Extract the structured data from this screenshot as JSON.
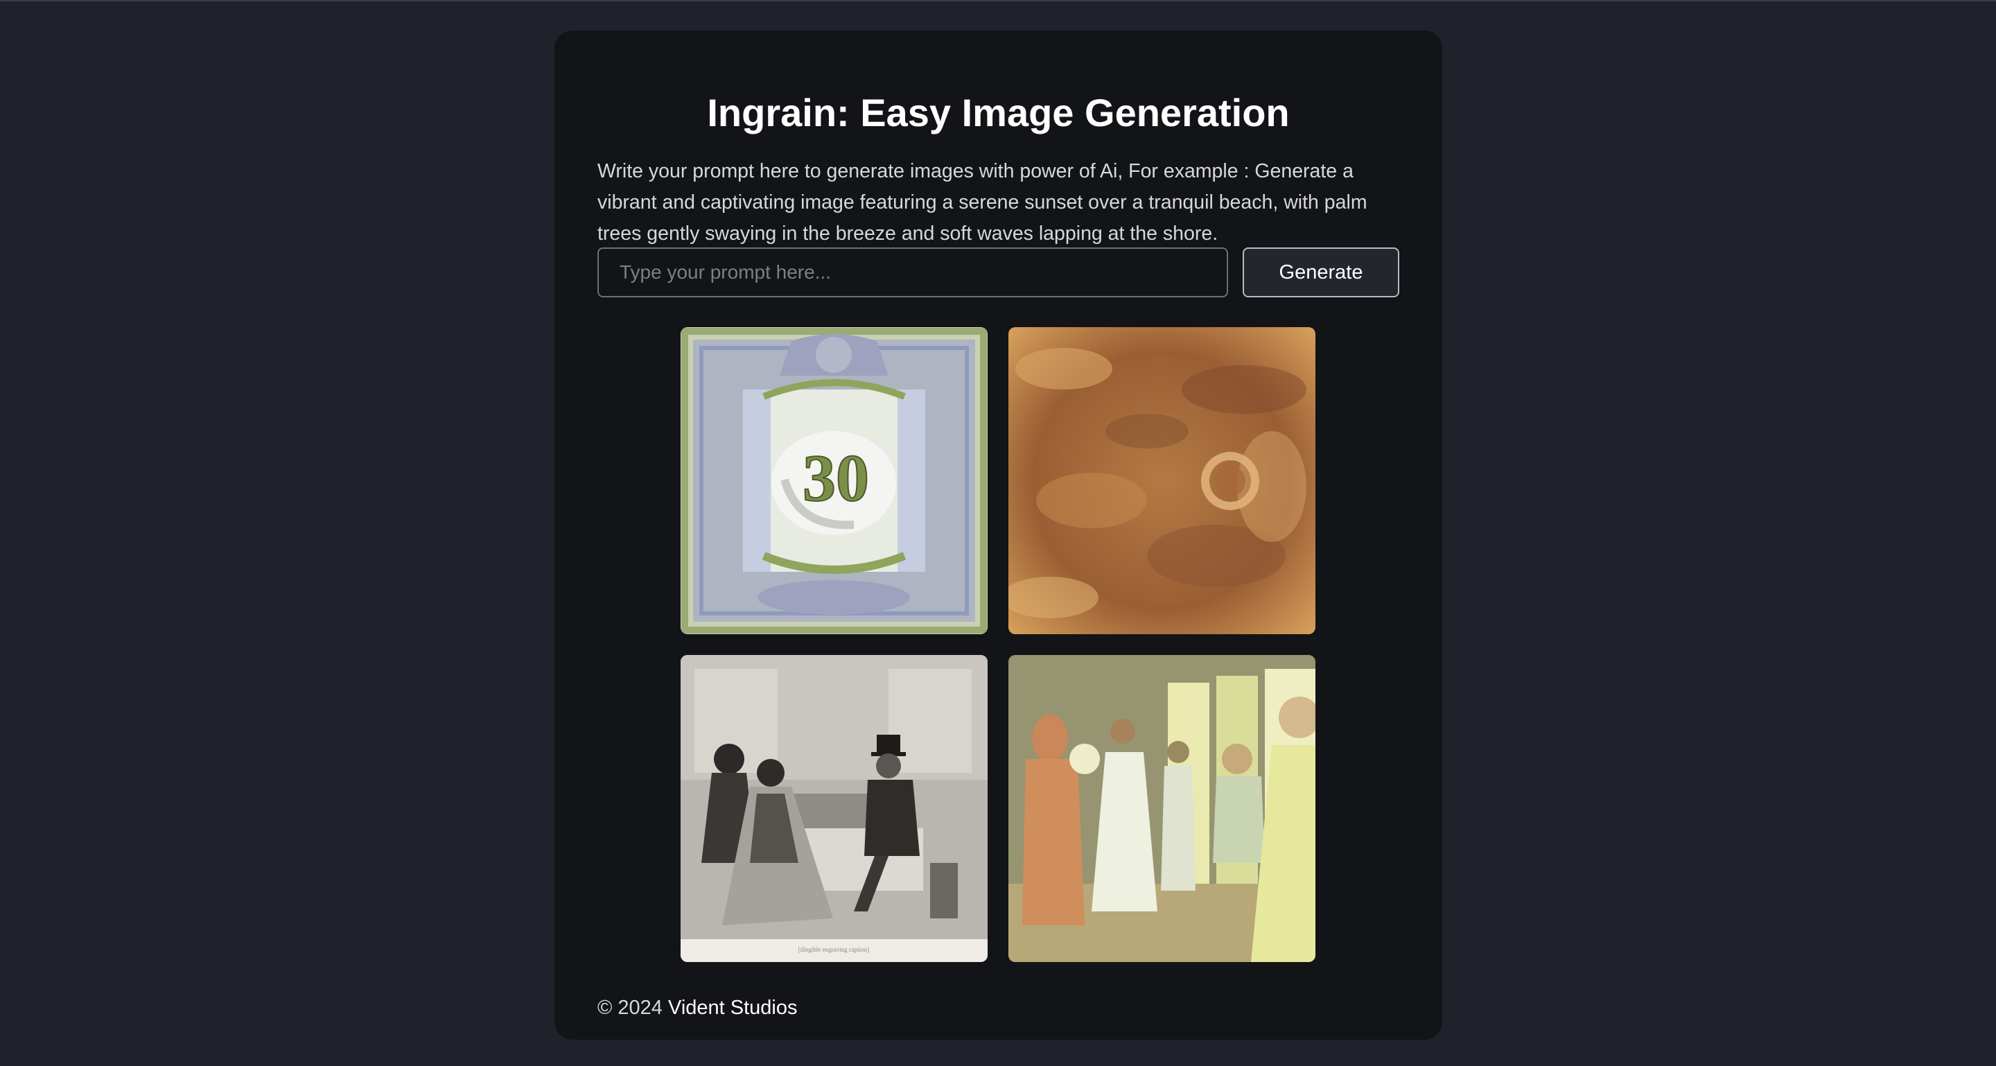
{
  "header": {
    "title": "Ingrain: Easy Image Generation",
    "description": "Write your prompt here to generate images with power of Ai, For example : Generate a vibrant and captivating image featuring a serene sunset over a tranquil beach, with palm trees gently swaying in the breeze and soft waves lapping at the shore."
  },
  "prompt": {
    "value": "",
    "placeholder": "Type your prompt here..."
  },
  "generate_button": {
    "label": "Generate"
  },
  "gallery": {
    "images": [
      {
        "subject": "ornate-banknote-30",
        "badge_text": "30"
      },
      {
        "subject": "amber-marble-texture"
      },
      {
        "subject": "victorian-parlor-engraving",
        "caption_text": "[illegible engraving caption]"
      },
      {
        "subject": "figures-by-window-painting"
      }
    ]
  },
  "footer": {
    "copyright": "© 2024",
    "brand": "Vident Studios"
  },
  "colors": {
    "page_background": "#1f222b",
    "card_background": "#131417",
    "text_primary": "#ffffff",
    "text_secondary": "#d7d8dc",
    "input_border": "#6e7079",
    "button_border": "#b8bac0"
  }
}
